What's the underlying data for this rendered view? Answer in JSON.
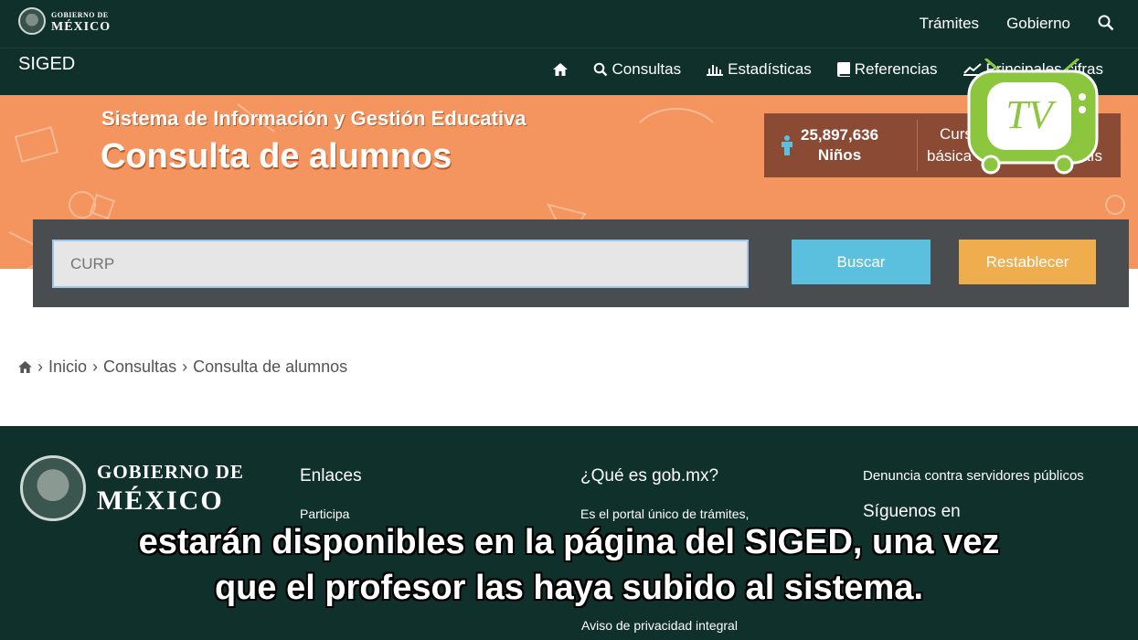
{
  "header": {
    "gov_logo": {
      "line1": "GOBIERNO DE",
      "line2": "MÉXICO"
    },
    "top_links": [
      "Trámites",
      "Gobierno"
    ],
    "search_icon": "search-icon"
  },
  "nav": {
    "brand": "SIGED",
    "items": [
      {
        "label": "",
        "icon": "home-icon"
      },
      {
        "label": "Consultas",
        "icon": "search-icon"
      },
      {
        "label": "Estadísticas",
        "icon": "bar-chart-icon"
      },
      {
        "label": "Referencias",
        "icon": "book-icon"
      },
      {
        "label": "Principales cifras",
        "icon": "line-chart-icon"
      }
    ]
  },
  "banner": {
    "subtitle": "Sistema de Información y Gestión Educativa",
    "title": "Consulta de alumnos",
    "stats": {
      "kids_count": "25,897,636",
      "kids_label": "Niños",
      "course_line1": "Curs",
      "course_line2": "básica",
      "course_suffix": "país"
    }
  },
  "search": {
    "placeholder": "CURP",
    "search_label": "Buscar",
    "reset_label": "Restablecer"
  },
  "breadcrumb": [
    "Inicio",
    "Consultas",
    "Consulta de alumnos"
  ],
  "footer": {
    "logo": {
      "line1": "GOBIERNO DE",
      "line2": "MÉXICO"
    },
    "col1": {
      "title": "Enlaces",
      "links": [
        "Participa"
      ]
    },
    "col2": {
      "title": "¿Qué es gob.mx?",
      "links": [
        "Es el portal único de trámites,"
      ],
      "privacy": "Aviso de privacidad integral"
    },
    "col3": {
      "denuncia": "Denuncia contra servidores públicos",
      "title": "Síguenos en"
    }
  },
  "subtitles": {
    "line1": "estarán disponibles en la página del SIGED, una vez",
    "line2": "que el profesor las haya subido al sistema."
  },
  "overlay": {
    "tv_logo_text": "TV"
  },
  "colors": {
    "dark_green": "#10312b",
    "banner_orange": "#f4945e",
    "search_blue": "#5bc0de",
    "reset_orange": "#f0ad4e",
    "tv_green": "#8cc63f"
  }
}
